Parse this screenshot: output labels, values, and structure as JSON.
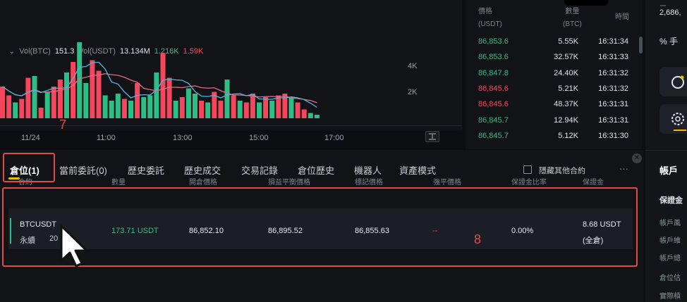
{
  "volume_legend": {
    "label": "Vol(BTC)",
    "value_btc": "151.3",
    "label2": "Vol(USDT)",
    "value_usdt": "13.134M",
    "ma_green": "1.216K",
    "ma_red": "1.59K"
  },
  "chart_data": {
    "type": "bar",
    "title": "",
    "y_ticks": [
      "4K",
      "2K"
    ],
    "x_ticks": [
      "11/24",
      "11:00",
      "13:00",
      "15:00",
      "17:00"
    ],
    "colors": {
      "up": "#2ebd85",
      "down": "#f6465d",
      "ma1": "#e26b86",
      "ma2": "#56b3d9"
    },
    "values": [
      1800,
      1300,
      900,
      1100,
      2300,
      2400,
      600,
      1500,
      1800,
      2200,
      2600,
      3200,
      4700,
      2000,
      3300,
      2700,
      1300,
      1000,
      1400,
      1100,
      1000,
      2000,
      1200,
      1300,
      2600,
      3700,
      2300,
      1000,
      1200,
      1700,
      1400,
      1000,
      900,
      1500,
      1000,
      2200,
      1300,
      1000,
      900,
      1400,
      900,
      1200,
      1000,
      1300,
      1400,
      1200,
      900,
      500,
      300,
      200
    ],
    "directions": [
      "down",
      "down",
      "up",
      "down",
      "down",
      "up",
      "down",
      "up",
      "down",
      "down",
      "up",
      "down",
      "up",
      "up",
      "down",
      "down",
      "up",
      "up",
      "up",
      "down",
      "up",
      "down",
      "up",
      "up",
      "up",
      "down",
      "down",
      "up",
      "down",
      "up",
      "up",
      "down",
      "up",
      "down",
      "down",
      "up",
      "down",
      "up",
      "down",
      "down",
      "up",
      "down",
      "up",
      "down",
      "down",
      "up",
      "down",
      "down",
      "up",
      "up"
    ]
  },
  "trades": {
    "header": {
      "price": "價格",
      "price_unit": "(USDT)",
      "qty": "數量",
      "qty_unit": "(BTC)",
      "time": "時間"
    },
    "rows": [
      {
        "price": "86,853.6",
        "dir": "up",
        "qty": "5.55K",
        "time": "16:31:34"
      },
      {
        "price": "86,853.6",
        "dir": "up",
        "qty": "32.57K",
        "time": "16:31:33"
      },
      {
        "price": "86,847.8",
        "dir": "up",
        "qty": "24.40K",
        "time": "16:31:32"
      },
      {
        "price": "86,845.6",
        "dir": "down",
        "qty": "5.21K",
        "time": "16:31:32"
      },
      {
        "price": "86,845.6",
        "dir": "down",
        "qty": "48.37K",
        "time": "16:31:31"
      },
      {
        "price": "86,845.7",
        "dir": "up",
        "qty": "12.94K",
        "time": "16:31:31"
      },
      {
        "price": "86,845.7",
        "dir": "up",
        "qty": "5.12K",
        "time": "16:31:30"
      }
    ]
  },
  "right_panel": {
    "balance": "2,686,",
    "percent_label": "% 手",
    "account_title": "帳戶",
    "margin_title": "保證金",
    "rows": [
      "帳戶風",
      "帳戶維",
      "帳戶總",
      "倉位估",
      "實際槓"
    ]
  },
  "tabs": [
    {
      "label": "倉位(1)",
      "active": true
    },
    {
      "label": "當前委託(0)"
    },
    {
      "label": "歷史委託"
    },
    {
      "label": "歷史成交"
    },
    {
      "label": "交易記錄"
    },
    {
      "label": "倉位歷史"
    },
    {
      "label": "機器人"
    },
    {
      "label": "資產模式"
    }
  ],
  "hide_other_label": "隱藏其他合約",
  "more_label": "···",
  "columns": [
    "合約",
    "數量",
    "開倉價格",
    "損益平衡價格",
    "標記價格",
    "強平價格",
    "保證金比率",
    "保證金"
  ],
  "position": {
    "symbol": "BTCUSDT",
    "type": "永續",
    "leverage": "20",
    "qty": "173.71 USDT",
    "entry_price": "86,852.10",
    "breakeven_price": "86,895.52",
    "mark_price": "86,855.63",
    "liq_price": "--",
    "margin_ratio": "0.00%",
    "margin": "8.68 USDT",
    "margin_mode": "(全倉)"
  },
  "annotations": {
    "box7": "7",
    "box8": "8"
  }
}
